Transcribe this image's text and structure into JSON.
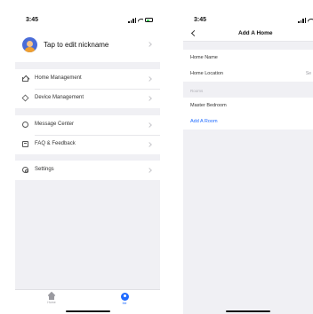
{
  "colors": {
    "accent": "#1f6bff",
    "background": "#f0f0f4",
    "row": "#ffffff"
  },
  "left": {
    "status_time": "3:45",
    "profile": {
      "nickname": "Tap to edit nickname",
      "avatar_icon": "user-avatar-icon"
    },
    "menu_groups": [
      [
        {
          "label": "Home Management",
          "icon": "home-icon"
        },
        {
          "label": "Device Management",
          "icon": "device-icon"
        }
      ],
      [
        {
          "label": "Message Center",
          "icon": "message-icon"
        },
        {
          "label": "FAQ & Feedback",
          "icon": "faq-icon"
        }
      ],
      [
        {
          "label": "Settings",
          "icon": "settings-icon"
        }
      ]
    ],
    "tabbar": [
      {
        "label": "Home",
        "icon": "home-tab-icon",
        "active": false
      },
      {
        "label": "Me",
        "icon": "me-tab-icon",
        "active": true
      }
    ]
  },
  "right": {
    "status_time": "3:45",
    "title": "Add A Home",
    "fields": [
      {
        "label": "Home Name",
        "value": ""
      },
      {
        "label": "Home Location",
        "value": "Se"
      }
    ],
    "rooms_header": "Rooms",
    "rooms": [
      "Master Bedroom"
    ],
    "add_room": "Add A Room"
  }
}
